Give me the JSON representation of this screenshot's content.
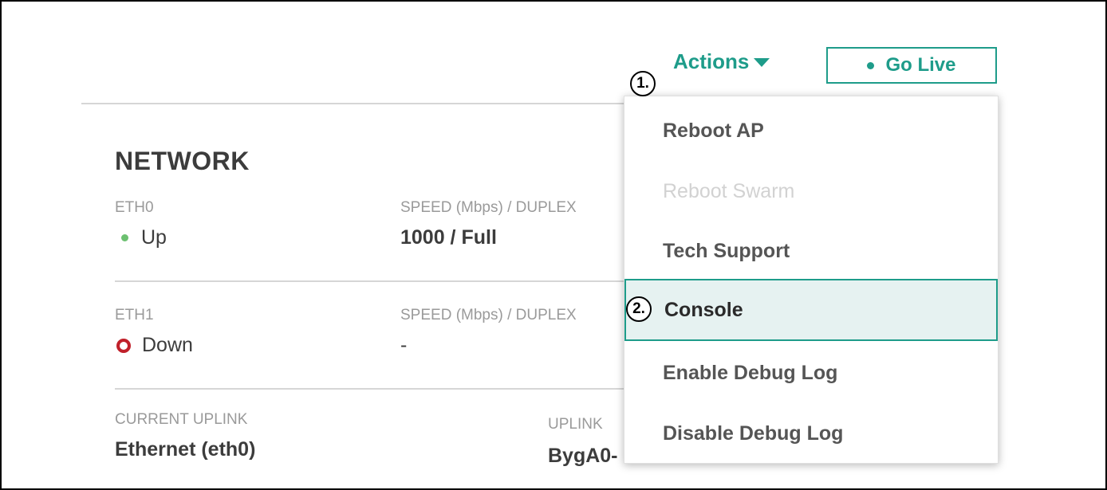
{
  "header": {
    "actions_label": "Actions",
    "go_live_label": "Go Live"
  },
  "annotations": {
    "step1": "1.",
    "step2": "2."
  },
  "network": {
    "title": "NETWORK",
    "eth0": {
      "label": "ETH0",
      "status": "Up",
      "speed_label": "SPEED (Mbps) / DUPLEX",
      "speed_value": "1000 / Full"
    },
    "eth1": {
      "label": "ETH1",
      "status": "Down",
      "speed_label": "SPEED (Mbps) / DUPLEX",
      "speed_value": "-"
    },
    "uplink": {
      "label": "CURRENT UPLINK",
      "value": "Ethernet (eth0)",
      "second_label": "UPLINK",
      "second_value": "BygA0-"
    }
  },
  "actions_menu": {
    "items": [
      {
        "label": "Reboot AP",
        "state": "enabled"
      },
      {
        "label": "Reboot Swarm",
        "state": "disabled"
      },
      {
        "label": "Tech Support",
        "state": "enabled"
      },
      {
        "label": "Console",
        "state": "highlighted"
      },
      {
        "label": "Enable Debug Log",
        "state": "enabled"
      },
      {
        "label": "Disable Debug Log",
        "state": "enabled"
      }
    ]
  },
  "colors": {
    "accent": "#1e9c8a",
    "status_up": "#6cc070",
    "status_down": "#c0202a"
  }
}
